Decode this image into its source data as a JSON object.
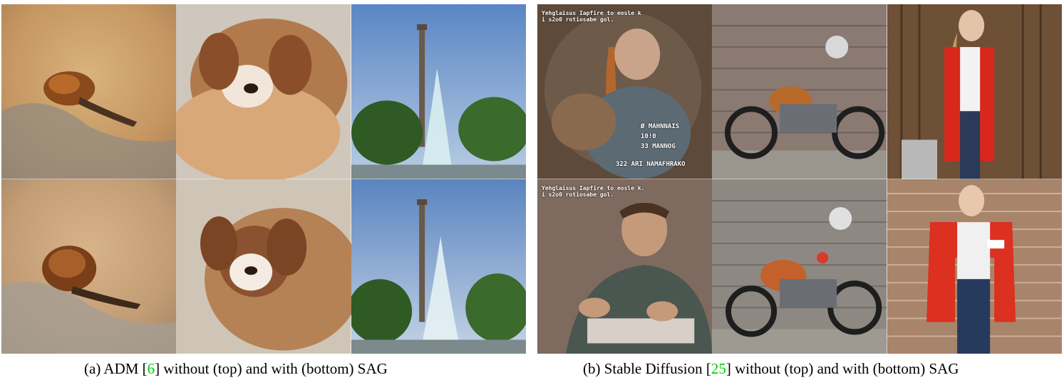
{
  "figure": {
    "caption_a": {
      "label": "(a) ADM [",
      "ref": "6",
      "rest": "] without (top) and with (bottom) SAG"
    },
    "caption_b": {
      "label": "(b) Stable Diffusion [",
      "ref": "25",
      "rest": "] without (top) and with (bottom) SAG"
    },
    "overlay_texts": {
      "sd_top_header_1": "Yehglaisus Iapfire to eosle k",
      "sd_top_header_2": "i s2o0 rotiosabe gol.",
      "sd_top_body_1": "Ø MAHNNAIS",
      "sd_top_body_2": "10!0",
      "sd_top_body_3": "33 MANNOG",
      "sd_top_body_4": "322 ARI NAMAFHRAKO",
      "sd_bottom_header_1": "Yehglaisus Iapfire to eosle k.",
      "sd_bottom_header_2": "i s2o0 rotiosabe gol."
    },
    "colors": {
      "ref_link": "#00cc00"
    }
  }
}
